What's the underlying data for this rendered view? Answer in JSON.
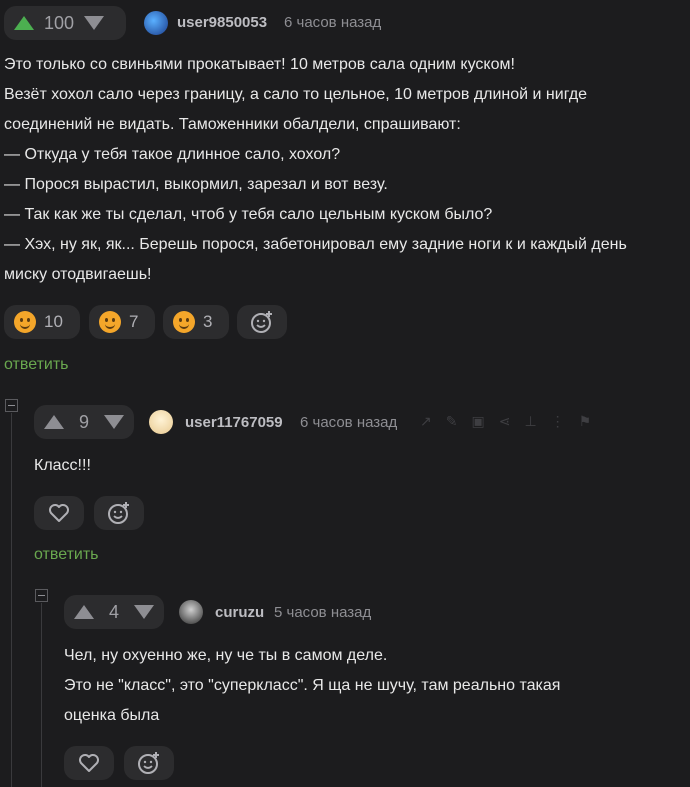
{
  "colors": {
    "background": "#1c1c1e",
    "upvote_active": "#4caf50",
    "reply_link": "#6aa84f"
  },
  "post": {
    "score": "100",
    "user": "user9850053",
    "time": "6 часов назад",
    "lines": [
      "Это только со свиньями прокатывает! 10 метров сала одним куском!",
      "Везёт хохол сало через границу, а сало то цельное, 10 метров длиной и нигде",
      "соединений не видать. Таможенники обалдели, спрашивают:",
      "— Откуда у тебя такое длинное сало, хохол?",
      "— Порося вырастил, выкормил, зарезал и вот везу.",
      "— Так как же ты сделал, чтоб у тебя сало цельным куском было?",
      "— Хэх, ну як, як... Берешь порося, забетонировал ему задние ноги к и каждый день",
      "миску отодвигаешь!"
    ],
    "reactions": [
      {
        "icon": "smirk-emoji-icon",
        "count": "10"
      },
      {
        "icon": "grin-emoji-icon",
        "count": "7"
      },
      {
        "icon": "laugh-emoji-icon",
        "count": "3"
      }
    ],
    "reply_label": "ответить"
  },
  "comment1": {
    "score": "9",
    "user": "user11767059",
    "time": "6 часов назад",
    "text": "Класс!!!",
    "reply_label": "ответить"
  },
  "comment2": {
    "score": "4",
    "user": "curuzu",
    "time": "5 часов назад",
    "lines": [
      "Чел, ну охуенно же, ну че ты в самом деле.",
      "Это не \"класс\", это \"суперкласс\". Я ща не шучу, там реально такая",
      "оценка была"
    ]
  }
}
